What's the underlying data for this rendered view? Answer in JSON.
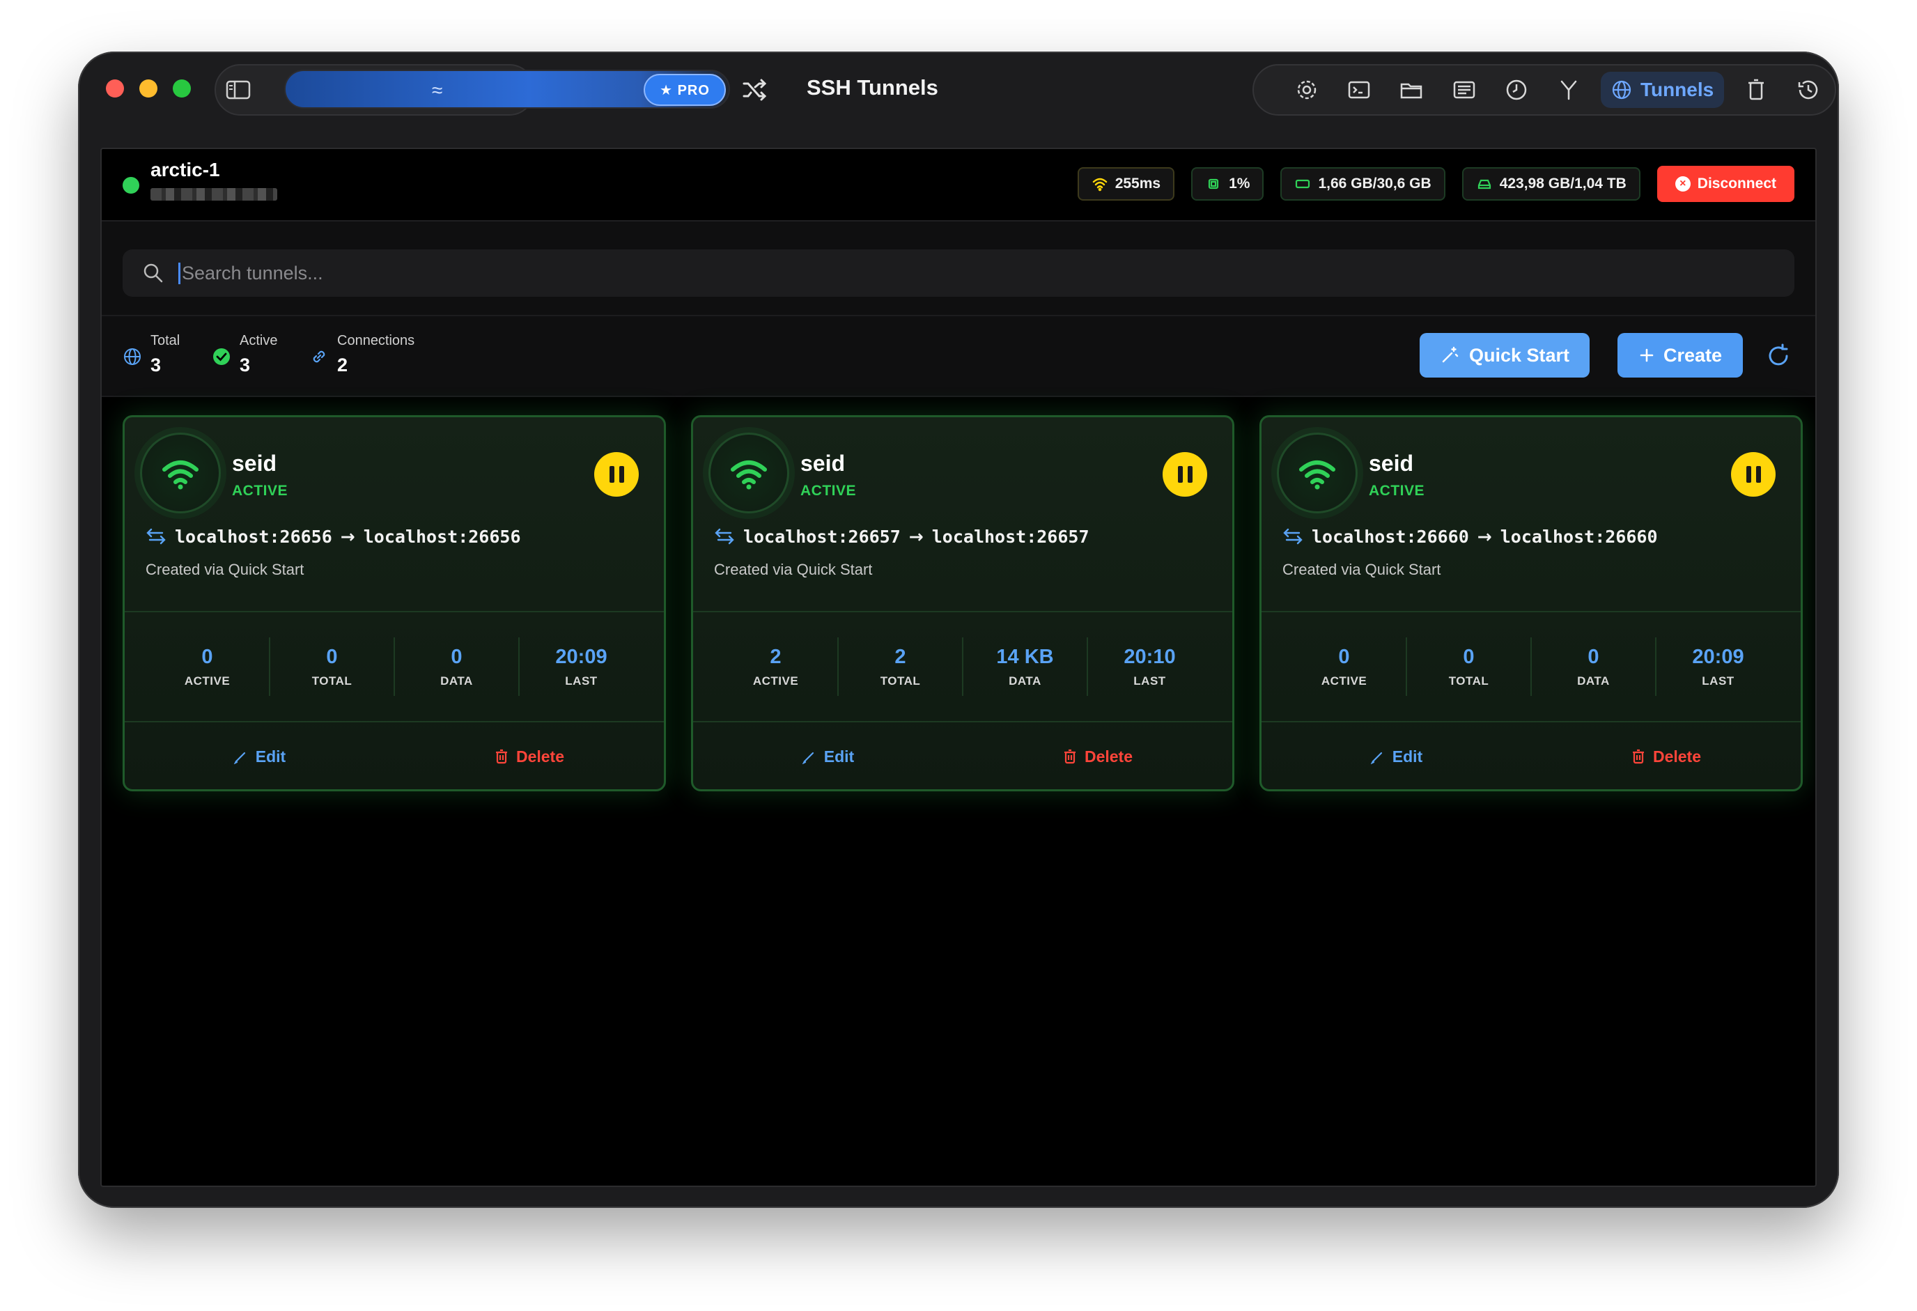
{
  "window": {
    "title": "SSH Tunnels",
    "pro_badge": "★ PRO",
    "toolbar": {
      "active_tab_label": "Tunnels",
      "icons": [
        "settings-icon",
        "terminal-icon",
        "folder-icon",
        "list-icon",
        "clock-icon",
        "fork-icon",
        "globe-icon",
        "trash-icon",
        "history-icon"
      ]
    }
  },
  "connection": {
    "name": "arctic-1",
    "status_color": "#30d158",
    "latency": "255ms",
    "cpu": "1%",
    "memory": "1,66 GB/30,6 GB",
    "disk": "423,98 GB/1,04 TB",
    "disconnect_label": "Disconnect"
  },
  "search": {
    "placeholder": "Search tunnels..."
  },
  "summary": {
    "total_label": "Total",
    "total_value": "3",
    "active_label": "Active",
    "active_value": "3",
    "connections_label": "Connections",
    "connections_value": "2",
    "quick_start_label": "Quick Start",
    "create_label": "Create"
  },
  "tunnels": [
    {
      "name": "seid",
      "status": "ACTIVE",
      "local": "localhost:26656",
      "remote": "localhost:26656",
      "description": "Created via Quick Start",
      "active": "0",
      "total": "0",
      "data": "0",
      "last": "20:09"
    },
    {
      "name": "seid",
      "status": "ACTIVE",
      "local": "localhost:26657",
      "remote": "localhost:26657",
      "description": "Created via Quick Start",
      "active": "2",
      "total": "2",
      "data": "14 KB",
      "last": "20:10"
    },
    {
      "name": "seid",
      "status": "ACTIVE",
      "local": "localhost:26660",
      "remote": "localhost:26660",
      "description": "Created via Quick Start",
      "active": "0",
      "total": "0",
      "data": "0",
      "last": "20:09"
    }
  ],
  "labels": {
    "active": "ACTIVE",
    "total": "TOTAL",
    "data": "DATA",
    "last": "LAST",
    "edit": "Edit",
    "delete": "Delete",
    "arrow": "→"
  },
  "colors": {
    "accent": "#4f9bf4",
    "active_green": "#30d158",
    "pause_yellow": "#ffd60a",
    "danger": "#ff3b30"
  }
}
